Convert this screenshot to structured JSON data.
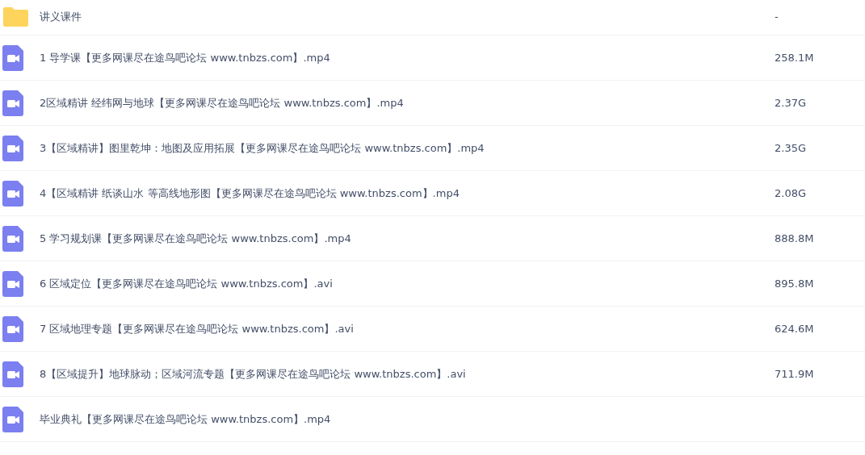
{
  "files": [
    {
      "kind": "folder",
      "name": "讲义课件",
      "size": "-"
    },
    {
      "kind": "video",
      "name": "1 导学课【更多网课尽在途鸟吧论坛 www.tnbzs.com】.mp4",
      "size": "258.1M"
    },
    {
      "kind": "video",
      "name": "2区域精讲 经纬网与地球【更多网课尽在途鸟吧论坛 www.tnbzs.com】.mp4",
      "size": "2.37G"
    },
    {
      "kind": "video",
      "name": "3【区域精讲】图里乾坤：地图及应用拓展【更多网课尽在途鸟吧论坛 www.tnbzs.com】.mp4",
      "size": "2.35G"
    },
    {
      "kind": "video",
      "name": "4【区域精讲 纸谈山水 等高线地形图【更多网课尽在途鸟吧论坛 www.tnbzs.com】.mp4",
      "size": "2.08G"
    },
    {
      "kind": "video",
      "name": "5 学习规划课【更多网课尽在途鸟吧论坛 www.tnbzs.com】.mp4",
      "size": "888.8M"
    },
    {
      "kind": "video",
      "name": "6 区域定位【更多网课尽在途鸟吧论坛 www.tnbzs.com】.avi",
      "size": "895.8M"
    },
    {
      "kind": "video",
      "name": "7 区域地理专题【更多网课尽在途鸟吧论坛 www.tnbzs.com】.avi",
      "size": "624.6M"
    },
    {
      "kind": "video",
      "name": "8【区域提升】地球脉动；区域河流专题【更多网课尽在途鸟吧论坛 www.tnbzs.com】.avi",
      "size": "711.9M"
    },
    {
      "kind": "video",
      "name": "毕业典礼【更多网课尽在途鸟吧论坛 www.tnbzs.com】.mp4"
    }
  ]
}
